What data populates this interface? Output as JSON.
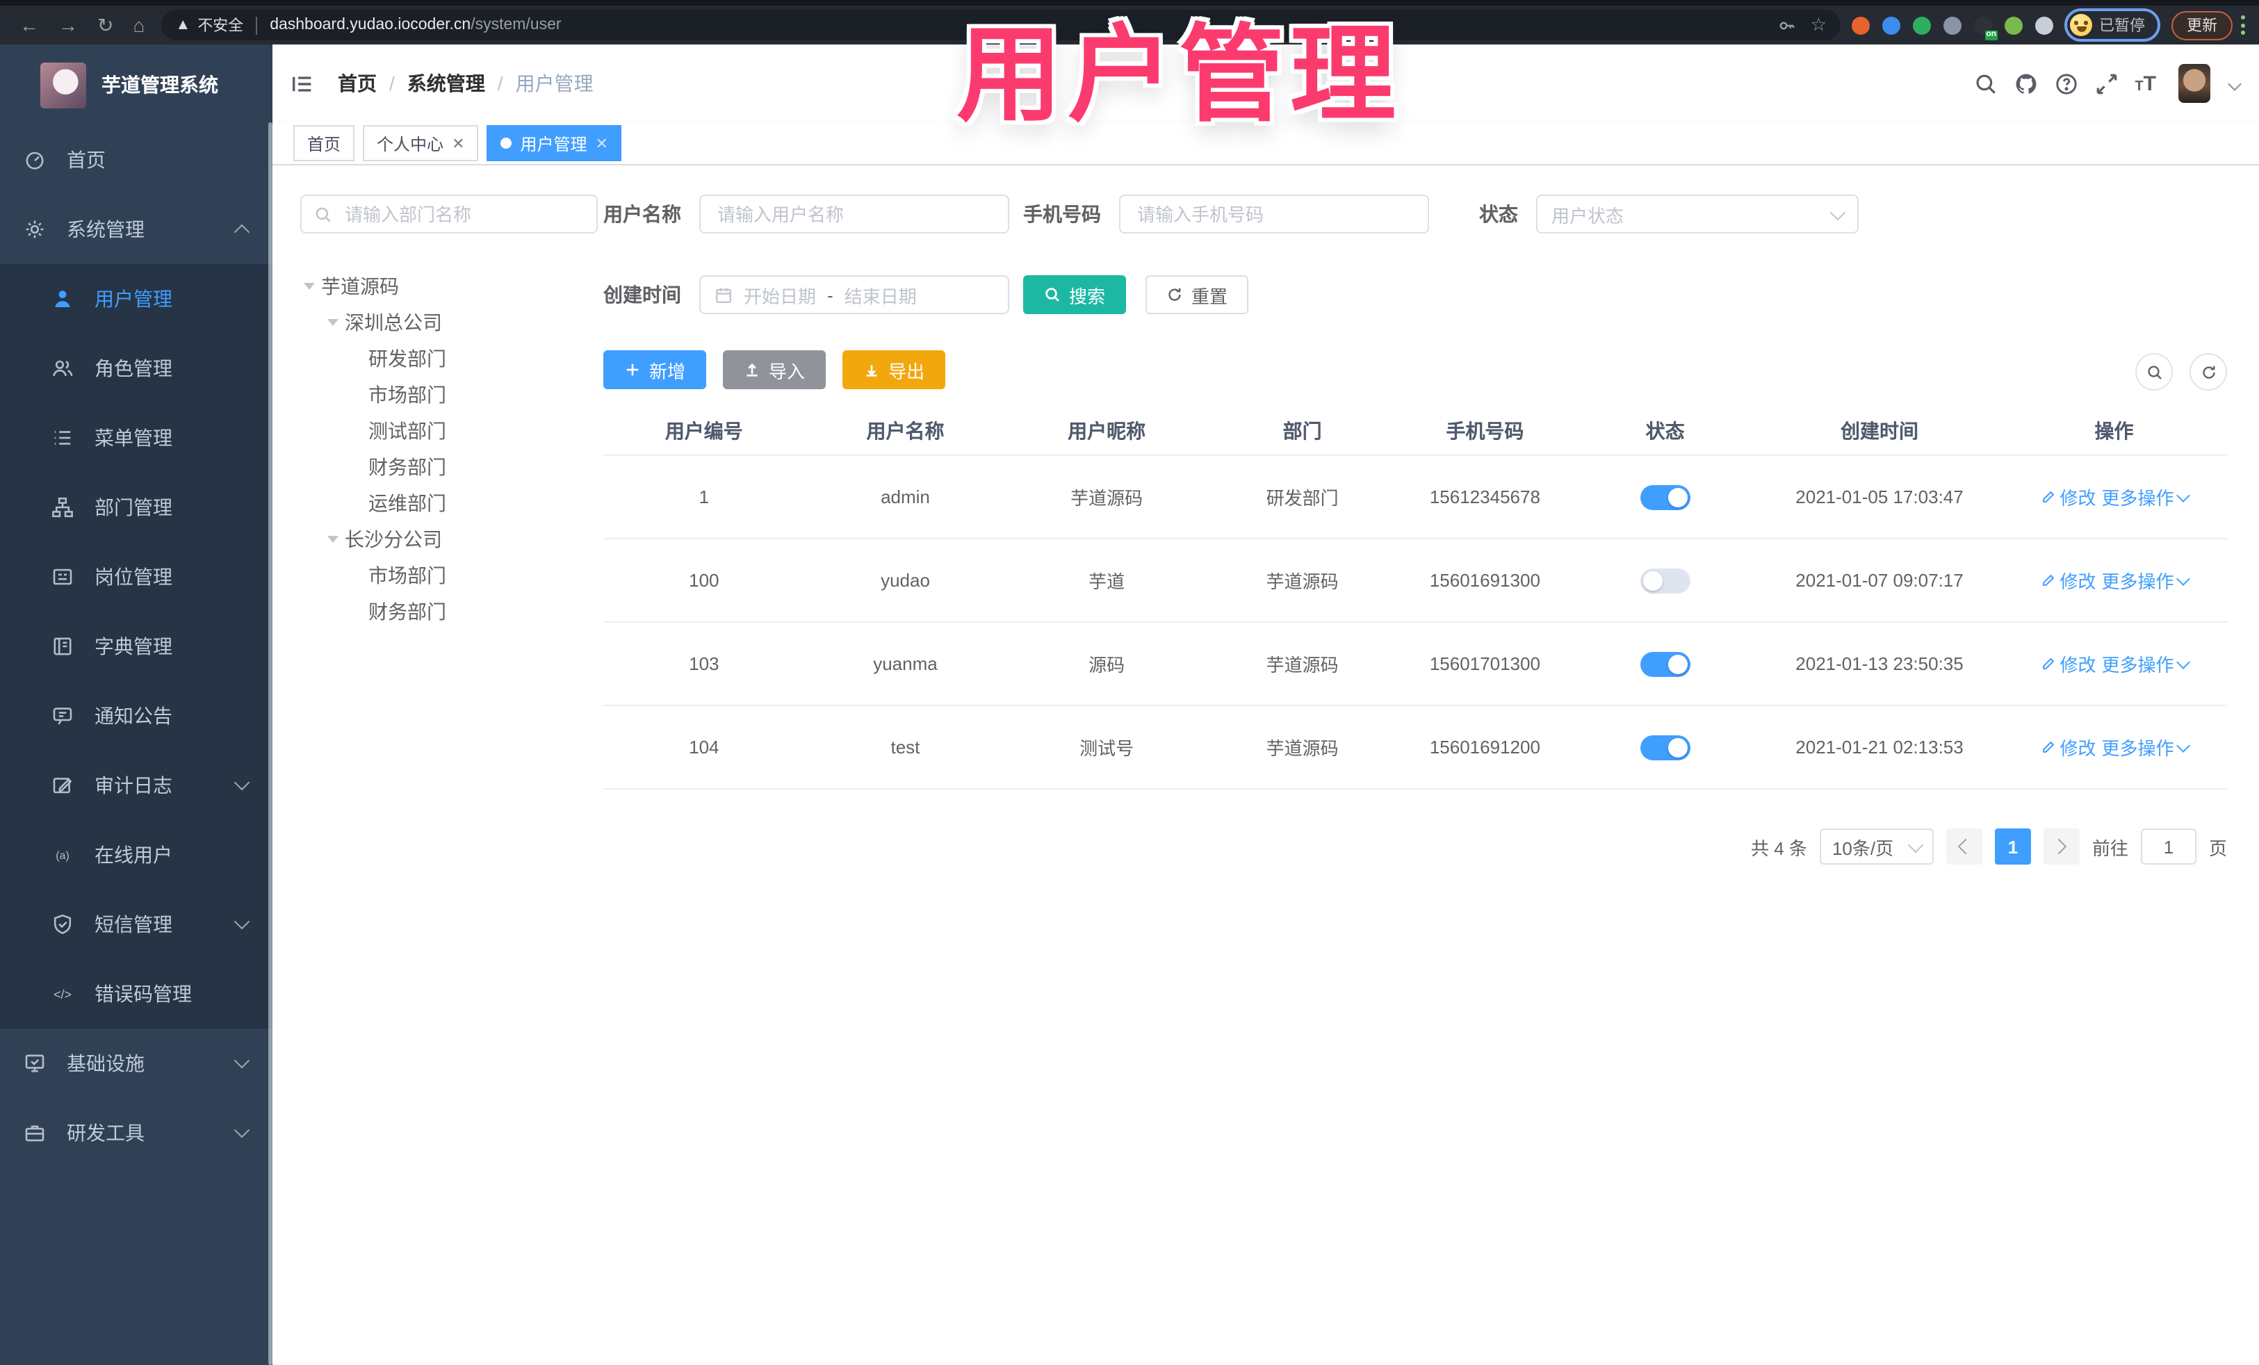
{
  "browser": {
    "nav_icons": [
      "back",
      "forward",
      "reload",
      "home"
    ],
    "security_label": "不安全",
    "url_host": "dashboard.yudao.iocoder.cn",
    "url_path": "/system/user",
    "extensions": [
      {
        "name": "ubuntu-extension-icon",
        "color": "#e8622c"
      },
      {
        "name": "pin-extension-icon",
        "color": "#3b8df0"
      },
      {
        "name": "y-extension-icon",
        "color": "#2fae5f"
      },
      {
        "name": "grid-extension-icon",
        "color": "#8b93a6"
      },
      {
        "name": "switch-on-extension-icon",
        "color": "#2e3138",
        "badge": "on",
        "badge_color": "#21a348"
      },
      {
        "name": "person-extension-icon",
        "color": "#79b94d"
      },
      {
        "name": "puzzle-extension-icon",
        "color": "#c9cdd6"
      }
    ],
    "profile_label": "已暂停",
    "update_label": "更新"
  },
  "watermark": {
    "text": "用户管理",
    "color": "#fb3b6e"
  },
  "sidebar": {
    "title": "芋道管理系统",
    "items": [
      {
        "label": "首页",
        "icon": "dashboard"
      },
      {
        "label": "系统管理",
        "icon": "gear",
        "expanded": true,
        "children": [
          {
            "label": "用户管理",
            "icon": "user",
            "active": true
          },
          {
            "label": "角色管理",
            "icon": "users"
          },
          {
            "label": "菜单管理",
            "icon": "list"
          },
          {
            "label": "部门管理",
            "icon": "tree"
          },
          {
            "label": "岗位管理",
            "icon": "badge"
          },
          {
            "label": "字典管理",
            "icon": "book"
          },
          {
            "label": "通知公告",
            "icon": "bubble"
          },
          {
            "label": "审计日志",
            "icon": "editlog",
            "collapsed": true
          },
          {
            "label": "在线用户",
            "icon": "online"
          },
          {
            "label": "短信管理",
            "icon": "shield",
            "collapsed": true
          },
          {
            "label": "错误码管理",
            "icon": "code"
          }
        ]
      },
      {
        "label": "基础设施",
        "icon": "infra",
        "collapsed": true
      },
      {
        "label": "研发工具",
        "icon": "tools",
        "collapsed": true
      }
    ]
  },
  "header": {
    "breadcrumb": [
      "首页",
      "系统管理",
      "用户管理"
    ],
    "breadcrumb_separator": "/"
  },
  "tabs": [
    {
      "label": "首页",
      "closable": false,
      "active": false
    },
    {
      "label": "个人中心",
      "closable": true,
      "active": false
    },
    {
      "label": "用户管理",
      "closable": true,
      "active": true
    }
  ],
  "tree": {
    "search_placeholder": "请输入部门名称",
    "nodes": [
      {
        "label": "芋道源码",
        "level": 0,
        "expandable": true
      },
      {
        "label": "深圳总公司",
        "level": 1,
        "expandable": true
      },
      {
        "label": "研发部门",
        "level": 2
      },
      {
        "label": "市场部门",
        "level": 2
      },
      {
        "label": "测试部门",
        "level": 2
      },
      {
        "label": "财务部门",
        "level": 2
      },
      {
        "label": "运维部门",
        "level": 2
      },
      {
        "label": "长沙分公司",
        "level": 1,
        "expandable": true
      },
      {
        "label": "市场部门",
        "level": 2
      },
      {
        "label": "财务部门",
        "level": 2
      }
    ]
  },
  "filters": {
    "username_label": "用户名称",
    "username_placeholder": "请输入用户名称",
    "mobile_label": "手机号码",
    "mobile_placeholder": "请输入手机号码",
    "status_label": "状态",
    "status_placeholder": "用户状态",
    "created_label": "创建时间",
    "start_placeholder": "开始日期",
    "range_separator": "-",
    "end_placeholder": "结束日期",
    "search_label": "搜索",
    "reset_label": "重置"
  },
  "toolbar": {
    "add_label": "新增",
    "import_label": "导入",
    "export_label": "导出"
  },
  "table": {
    "columns": [
      "用户编号",
      "用户名称",
      "用户昵称",
      "部门",
      "手机号码",
      "状态",
      "创建时间",
      "操作"
    ],
    "op": {
      "edit": "修改",
      "more": "更多操作"
    },
    "rows": [
      {
        "id": "1",
        "username": "admin",
        "nickname": "芋道源码",
        "dept": "研发部门",
        "mobile": "15612345678",
        "status": true,
        "created": "2021-01-05 17:03:47"
      },
      {
        "id": "100",
        "username": "yudao",
        "nickname": "芋道",
        "dept": "芋道源码",
        "mobile": "15601691300",
        "status": false,
        "created": "2021-01-07 09:07:17"
      },
      {
        "id": "103",
        "username": "yuanma",
        "nickname": "源码",
        "dept": "芋道源码",
        "mobile": "15601701300",
        "status": true,
        "created": "2021-01-13 23:50:35"
      },
      {
        "id": "104",
        "username": "test",
        "nickname": "测试号",
        "dept": "芋道源码",
        "mobile": "15601691200",
        "status": true,
        "created": "2021-01-21 02:13:53"
      }
    ]
  },
  "pagination": {
    "total_label": "共 4 条",
    "page_size": "10条/页",
    "current": "1",
    "goto_label": "前往",
    "goto_value": "1",
    "page_label": "页"
  },
  "colors": {
    "accent_blue": "#409eff",
    "teal": "#1db8a4",
    "warning": "#f2a70d",
    "info_gray": "#909399",
    "sidebar_bg": "#304156",
    "submenu_bg": "#263445",
    "watermark_pink": "#fb3b6e"
  }
}
